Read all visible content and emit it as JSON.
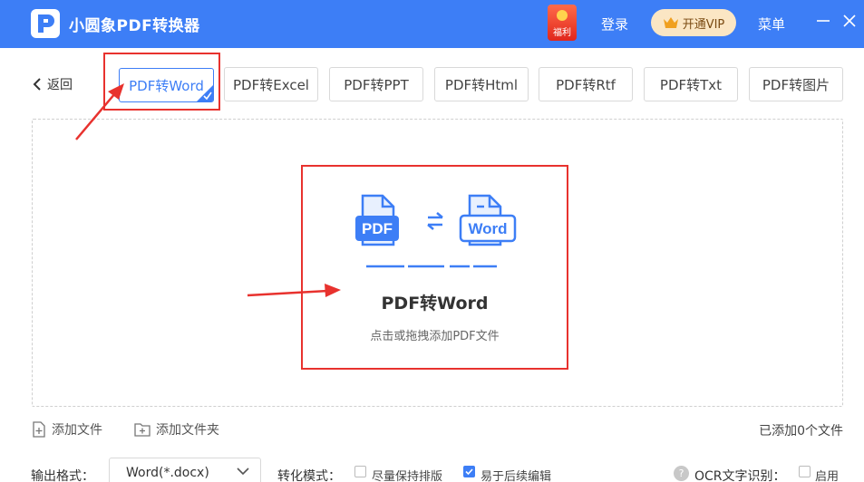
{
  "app": {
    "title": "小圆象PDF转换器",
    "gift_label": "福利",
    "login": "登录",
    "vip": "开通VIP",
    "menu": "菜单"
  },
  "nav": {
    "back": "返回",
    "tabs": [
      {
        "label": "PDF转Word",
        "active": true
      },
      {
        "label": "PDF转Excel",
        "active": false
      },
      {
        "label": "PDF转PPT",
        "active": false
      },
      {
        "label": "PDF转Html",
        "active": false
      },
      {
        "label": "PDF转Rtf",
        "active": false
      },
      {
        "label": "PDF转Txt",
        "active": false
      },
      {
        "label": "PDF转图片",
        "active": false
      }
    ]
  },
  "dropzone": {
    "pdf_badge": "PDF",
    "word_badge": "Word",
    "title": "PDF转Word",
    "hint": "点击或拖拽添加PDF文件"
  },
  "files": {
    "add_file": "添加文件",
    "add_folder": "添加文件夹",
    "count_text": "已添加0个文件"
  },
  "options": {
    "output_label": "输出格式：",
    "output_value": "Word(*.docx)",
    "mode_label": "转化模式：",
    "mode_options": [
      {
        "label": "尽量保持排版",
        "checked": false
      },
      {
        "label": "易于后续编辑",
        "checked": true
      }
    ],
    "ocr_label": "OCR文字识别：",
    "ocr_enable": {
      "label": "启用",
      "checked": false
    }
  },
  "colors": {
    "brand": "#3d7ef6",
    "highlight": "#e8322e",
    "vip_bg": "#fbe6c4"
  }
}
